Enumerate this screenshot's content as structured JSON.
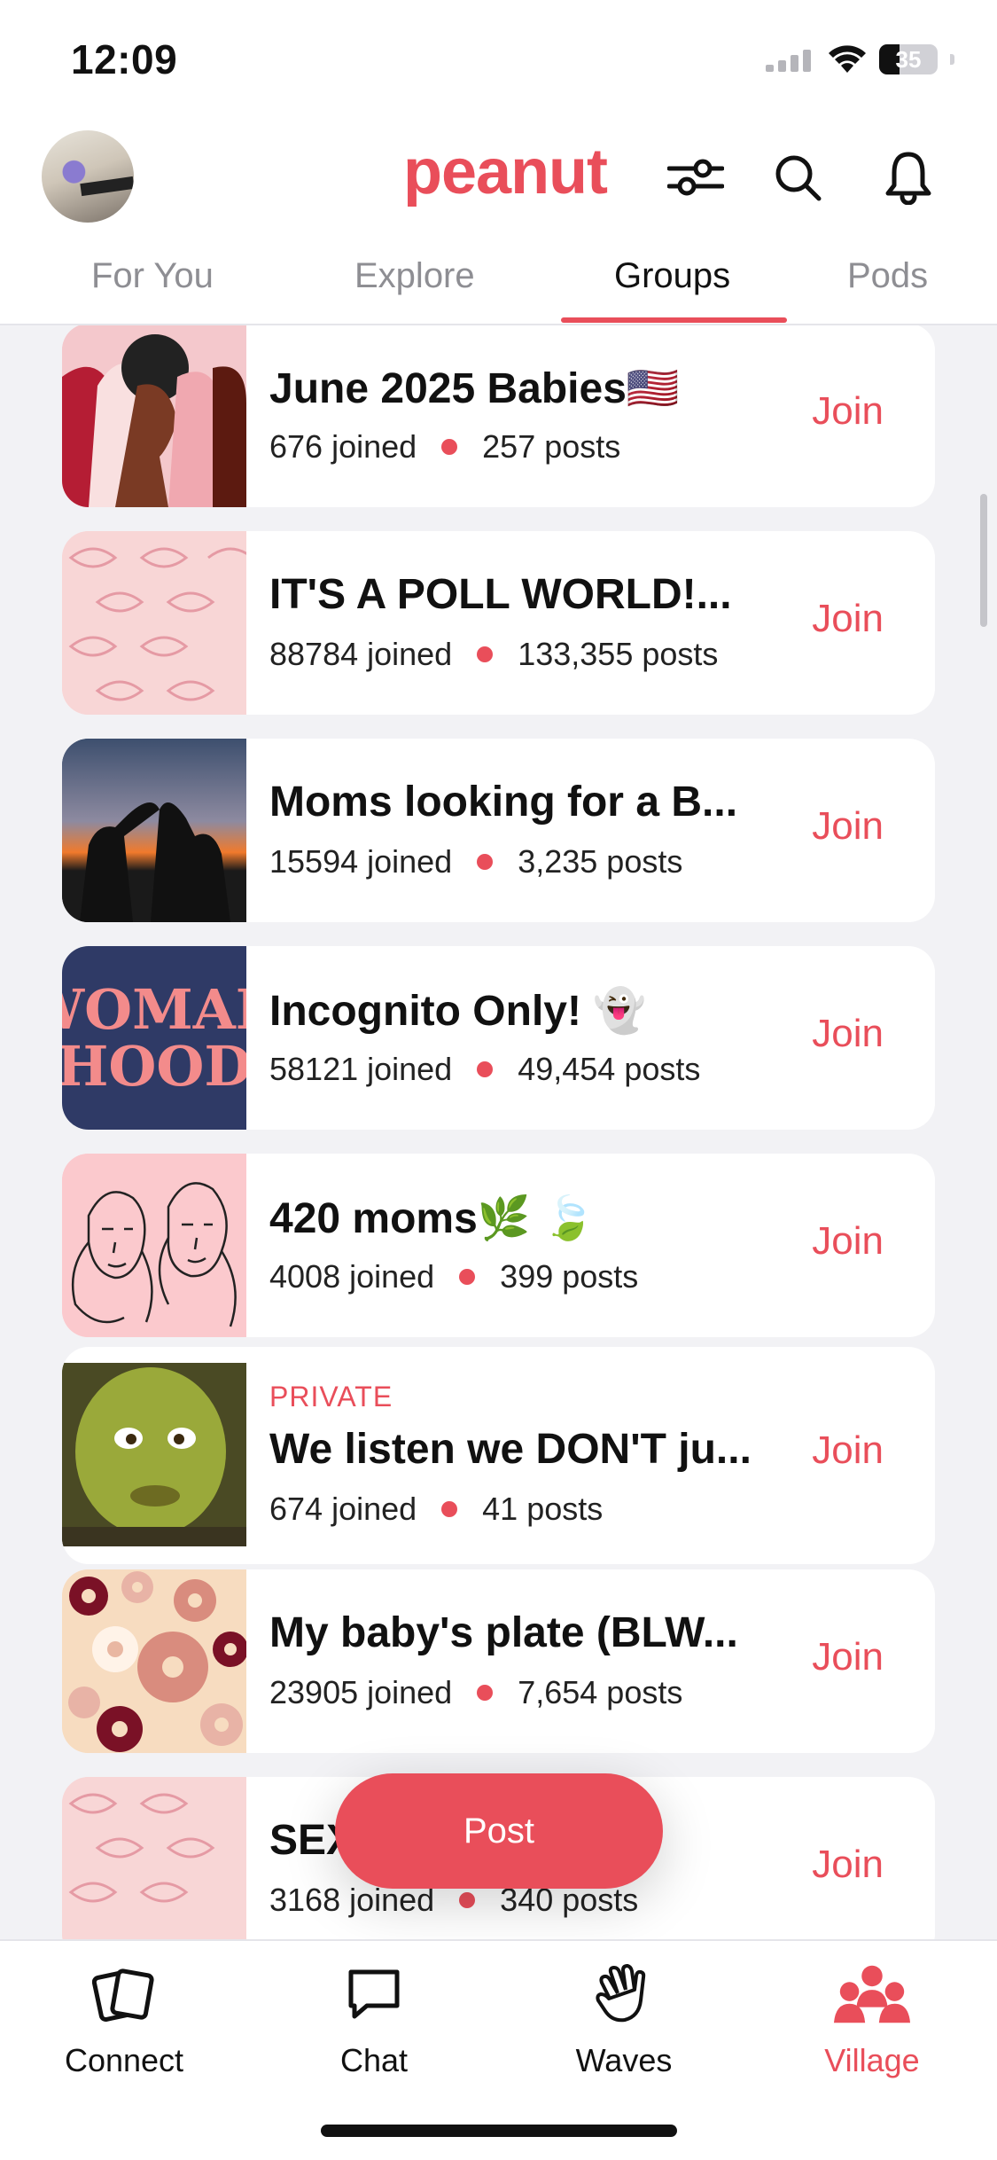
{
  "status": {
    "time": "12:09",
    "battery": "35",
    "battery_level": 0.35
  },
  "header": {
    "logo": "peanut"
  },
  "tabs": [
    {
      "label": "For You",
      "active": false
    },
    {
      "label": "Explore",
      "active": false
    },
    {
      "label": "Groups",
      "active": true
    },
    {
      "label": "Pods",
      "active": false
    }
  ],
  "groups": [
    {
      "name": "June 2025 Babies🇺🇸",
      "joined": "676 joined",
      "posts": "257 posts",
      "private": "",
      "join": "Join"
    },
    {
      "name": "IT'S A POLL WORLD!...",
      "joined": "88784 joined",
      "posts": "133,355 posts",
      "private": "",
      "join": "Join"
    },
    {
      "name": "Moms looking for a B...",
      "joined": "15594 joined",
      "posts": "3,235 posts",
      "private": "",
      "join": "Join"
    },
    {
      "name": "Incognito Only! 👻",
      "joined": "58121 joined",
      "posts": "49,454 posts",
      "private": "",
      "join": "Join"
    },
    {
      "name": "420 moms🌿 🍃",
      "joined": "4008 joined",
      "posts": "399 posts",
      "private": "",
      "join": "Join"
    },
    {
      "name": "We listen we DON'T ju...",
      "joined": "674 joined",
      "posts": "41 posts",
      "private": "PRIVATE",
      "join": "Join"
    },
    {
      "name": "My baby's plate (BLW...",
      "joined": "23905 joined",
      "posts": "7,654 posts",
      "private": "",
      "join": "Join"
    },
    {
      "name": "SEX ... AR...",
      "joined": "3168 joined",
      "posts": "340 posts",
      "private": "",
      "join": "Join"
    }
  ],
  "thumb_texts": {
    "womanhood_line1": "WOMAN",
    "womanhood_line2": "HOOD"
  },
  "post_button": "Post",
  "nav": [
    {
      "label": "Connect",
      "icon": "connect-cards-icon",
      "active": false
    },
    {
      "label": "Chat",
      "icon": "chat-bubble-icon",
      "active": false
    },
    {
      "label": "Waves",
      "icon": "wave-hand-icon",
      "active": false
    },
    {
      "label": "Village",
      "icon": "village-people-icon",
      "active": true
    }
  ],
  "colors": {
    "accent": "#e94e5a",
    "background": "#f2f2f5",
    "muted": "#8e8e93"
  }
}
